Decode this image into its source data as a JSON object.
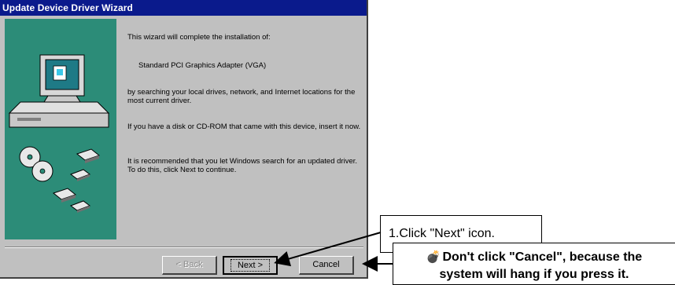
{
  "window": {
    "title": "Update Device Driver Wizard"
  },
  "content": {
    "intro": "This wizard will complete the installation of:",
    "device": "Standard PCI Graphics Adapter (VGA)",
    "search_text": "by searching your local drives, network, and Internet locations for the most current driver.",
    "disk_text": "If you have a disk or CD-ROM that came with this device, insert it now.",
    "recommend_text": "It is recommended that you let Windows search for an updated driver. To do this, click Next to continue."
  },
  "buttons": {
    "back": "< Back",
    "next": "Next >",
    "cancel": "Cancel"
  },
  "callouts": {
    "next_note": "1.Click \"Next\" icon.",
    "cancel_line1": "Don't click \"Cancel\", because the",
    "cancel_line2": "system will hang if you press it."
  },
  "colors": {
    "titlebar": "#0a1a8c",
    "art_background": "#2c8c78",
    "window_face": "#c0c0c0"
  }
}
